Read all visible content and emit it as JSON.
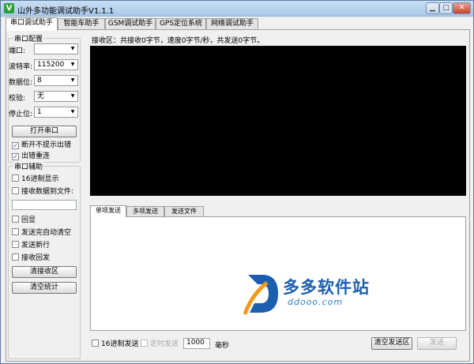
{
  "window": {
    "title": "山外多功能调试助手V1.1.1",
    "icon_letter": "V"
  },
  "tabs": [
    "串口调试助手",
    "智能车助手",
    "GSM调试助手",
    "GPS定位系统",
    "网络调试助手"
  ],
  "serial_config": {
    "group_title": "串口配置",
    "port_label": "端口:",
    "port_value": "",
    "baud_label": "波特率:",
    "baud_value": "115200",
    "databits_label": "数据位:",
    "databits_value": "8",
    "parity_label": "校验:",
    "parity_value": "无",
    "stopbits_label": "停止位:",
    "stopbits_value": "1",
    "open_button": "打开串口",
    "no_error_prompt": "断开不提示出错",
    "reconnect_on_error": "出错重连"
  },
  "serial_aux": {
    "group_title": "串口辅助",
    "hex_display": "16进制显示",
    "save_to_file": "接收数据到文件:",
    "echo": "回显",
    "auto_clear": "发送完自动清空",
    "send_newline": "发送新行",
    "receive_reply": "接收回发",
    "clear_rx_button": "清接收区",
    "clear_stats_button": "清空统计"
  },
  "receive": {
    "status": "接收区：共接收0字节，速度0字节/秒，共发送0字节。"
  },
  "send_tabs": [
    "单项发送",
    "多项发送",
    "发送文件"
  ],
  "send": {
    "hex_send": "16进制发送",
    "timed_send": "定时发送",
    "interval_value": "1000",
    "interval_unit": "毫秒",
    "clear_tx_button": "清空发送区",
    "send_button": "发送"
  },
  "watermark": {
    "text": "多多软件站",
    "url": "ddooo.com",
    "icon_letter": "D"
  },
  "colors": {
    "accent": "#1c5fb0",
    "screen_bg": "#000000",
    "logo_orange": "#f39a1e"
  }
}
